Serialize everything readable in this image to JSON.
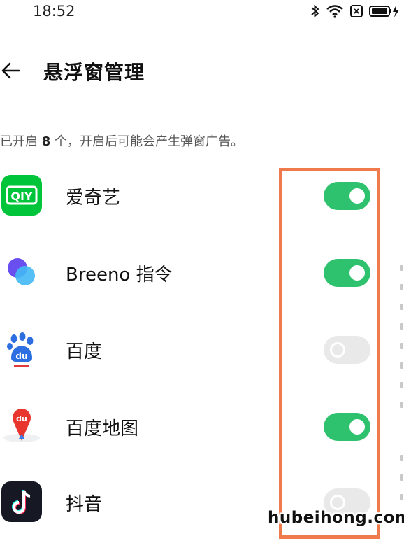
{
  "status_bar": {
    "time": "18:52",
    "icons": [
      "bluetooth-icon",
      "wifi-icon",
      "no-sim-icon",
      "battery-charging-icon"
    ]
  },
  "header": {
    "back_icon": "arrow-left-icon",
    "title": "悬浮窗管理"
  },
  "summary": {
    "prefix": "已开启 ",
    "count": "8",
    "suffix": " 个，开启后可能会产生弹窗广告。"
  },
  "apps": [
    {
      "name": "爱奇艺",
      "icon": "iqiyi-icon",
      "enabled": true
    },
    {
      "name": "Breeno 指令",
      "icon": "breeno-icon",
      "enabled": true
    },
    {
      "name": "百度",
      "icon": "baidu-icon",
      "enabled": false
    },
    {
      "name": "百度地图",
      "icon": "baidu-map-icon",
      "enabled": true
    },
    {
      "name": "抖音",
      "icon": "douyin-icon",
      "enabled": false
    }
  ],
  "colors": {
    "toggle_on": "#2ec26e",
    "toggle_off": "#e9e9e9",
    "highlight_box": "#ef7a4c"
  },
  "watermark": "hubeihong.com"
}
